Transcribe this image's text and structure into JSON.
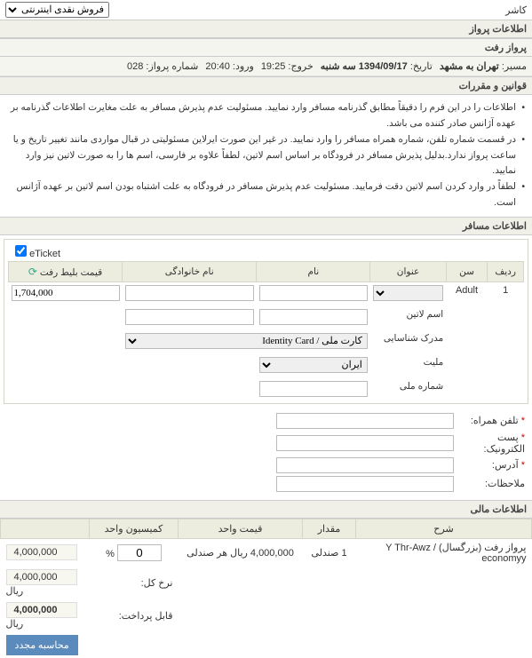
{
  "top": {
    "cashier_label": "کاشر",
    "sale_type": "فروش نقدی اینترنتی"
  },
  "info_header": "اطلاعات پرواز",
  "depart_header": "پرواز رفت",
  "flight": {
    "route_label": "مسیر:",
    "route": "تهران به مشهد",
    "date_label": "تاریخ:",
    "date": "1394/09/17 سه شنبه",
    "dep_label": "خروج:",
    "dep": "19:25",
    "arr_label": "ورود:",
    "arr": "20:40",
    "flno_label": "شماره پرواز:",
    "flno": "028"
  },
  "rules_header": "قوانین و مقررات",
  "rules": [
    "اطلاعات را در این فرم را دقیقاً مطابق گذرنامه مسافر وارد نمایید. مسئولیت عدم پذیرش مسافر به علت مغایرت اطلاعات گذرنامه بر عهده آژانس صادر کننده می باشد.",
    "در قسمت شماره تلفن، شماره همراه مسافر را وارد نمایید. در غیر این صورت ایرلاین مسئولیتی در قبال مواردی مانند تغییر تاریخ و یا ساعت پرواز ندارد.بدلیل پذیرش مسافر در فرودگاه بر اساس اسم لاتین، لطفاً علاوه بر فارسی، اسم ها را به صورت لاتین نیز وارد نمایید.",
    "لطفاً در وارد کردن اسم لاتین دقت فرمایید. مسئولیت عدم پذیرش مسافر در فرودگاه به علت اشتباه بودن اسم لاتین بر عهده آژانس است."
  ],
  "pax_header": "اطلاعات مسافر",
  "eticket_label": "eTicket",
  "cols": {
    "row": "ردیف",
    "age": "سن",
    "title": "عنوان",
    "fname": "نام",
    "lname": "نام خانوادگی",
    "price": "قیمت بلیط رفت"
  },
  "pax": {
    "idx": "1",
    "age": "Adult",
    "price": "1,704,000"
  },
  "sub": {
    "latin_name": "اسم لاتین",
    "id_doc_label": "مدرک شناسایی",
    "id_doc": "کارت ملی / Identity Card",
    "nat_label": "ملیت",
    "nat": "ایران",
    "nid_label": "شماره ملی"
  },
  "contact": {
    "mobile": "تلفن همراه:",
    "email": "پست الکترونیک:",
    "address": "آدرس:",
    "notes": "ملاحظات:"
  },
  "fin_header": "اطلاعات مالی",
  "fin_cols": {
    "desc": "شرح",
    "qty": "مقدار",
    "unit": "قیمت واحد",
    "comm": "کمیسیون واحد",
    "blank": ""
  },
  "fin_row": {
    "desc": "پرواز رفت (بزرگسال) / Y Thr-Awz economyy",
    "qty": "1 صندلی",
    "unit": "4,000,000 ریال هر صندلی",
    "comm_val": "0",
    "comm_unit": "%",
    "amount": "4,000,000"
  },
  "totals": {
    "gross_label": "نرخ کل:",
    "gross": "4,000,000",
    "currency": "ریال",
    "payable_label": "قابل پرداخت:",
    "payable": "4,000,000"
  },
  "recalc": "محاسبه مجدد"
}
